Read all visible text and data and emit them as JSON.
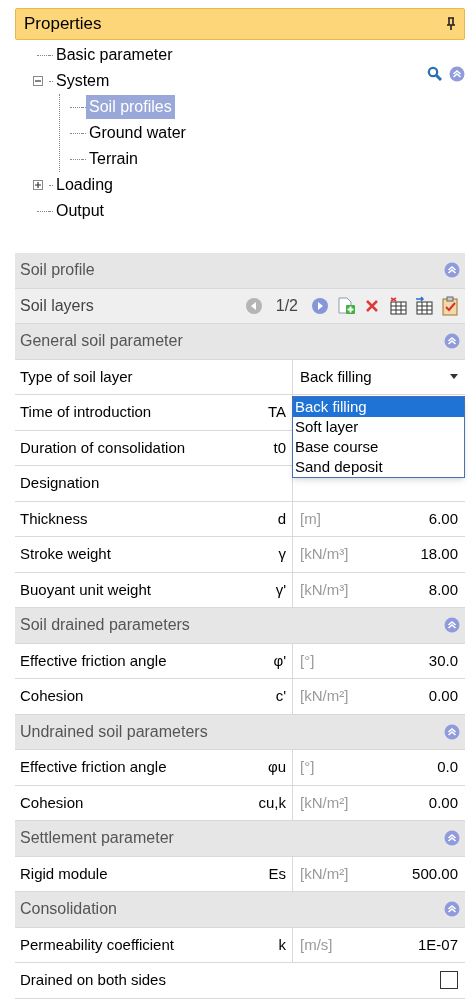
{
  "panel": {
    "title": "Properties"
  },
  "tree": [
    {
      "label": "Basic parameter",
      "selected": false
    },
    {
      "label": "System",
      "selected": false,
      "expanded": true,
      "children": [
        {
          "label": "Soil profiles",
          "selected": true
        },
        {
          "label": "Ground water",
          "selected": false
        },
        {
          "label": "Terrain",
          "selected": false
        }
      ]
    },
    {
      "label": "Loading",
      "selected": false,
      "expanded": false
    },
    {
      "label": "Output",
      "selected": false
    }
  ],
  "rows": [
    {
      "kind": "group",
      "title": "Soil profile",
      "expanded": true
    },
    {
      "kind": "pager",
      "label": "Soil layers",
      "page": "1/2"
    },
    {
      "kind": "group",
      "title": "General soil parameter",
      "expanded": true
    },
    {
      "kind": "select",
      "label": "Type of soil layer",
      "value": "Back filling",
      "open": true,
      "options": [
        {
          "label": "Back filling",
          "selected": true
        },
        {
          "label": "Soft layer",
          "selected": false
        },
        {
          "label": "Base course",
          "selected": false
        },
        {
          "label": "Sand deposit",
          "selected": false
        }
      ]
    },
    {
      "kind": "param",
      "label": "Time of introduction",
      "symbol": "TA"
    },
    {
      "kind": "param",
      "label": "Duration of consolidation",
      "symbol": "t0"
    },
    {
      "kind": "param",
      "label": "Designation"
    },
    {
      "kind": "param",
      "label": "Thickness",
      "symbol": "d",
      "unit": "[m]",
      "value": "6.00"
    },
    {
      "kind": "param",
      "label": "Stroke weight",
      "symbol": "γ",
      "unit": "[kN/m³]",
      "value": "18.00"
    },
    {
      "kind": "param",
      "label": "Buoyant unit weight",
      "symbol": "γ'",
      "unit": "[kN/m³]",
      "value": "8.00"
    },
    {
      "kind": "group",
      "title": "Soil drained parameters",
      "expanded": true
    },
    {
      "kind": "param",
      "label": "Effective friction angle",
      "symbol": "φ'",
      "unit": "[°]",
      "value": "30.0"
    },
    {
      "kind": "param",
      "label": "Cohesion",
      "symbol": "c'",
      "unit": "[kN/m²]",
      "value": "0.00"
    },
    {
      "kind": "group",
      "title": "Undrained soil parameters",
      "expanded": true
    },
    {
      "kind": "param",
      "label": "Effective friction angle",
      "symbol": "φu",
      "unit": "[°]",
      "value": "0.0"
    },
    {
      "kind": "param",
      "label": "Cohesion",
      "symbol": "cu,k",
      "unit": "[kN/m²]",
      "value": "0.00"
    },
    {
      "kind": "group",
      "title": "Settlement parameter",
      "expanded": true
    },
    {
      "kind": "param",
      "label": "Rigid module",
      "symbol": "Es",
      "unit": "[kN/m²]",
      "value": "500.00"
    },
    {
      "kind": "group",
      "title": "Consolidation",
      "expanded": true
    },
    {
      "kind": "param",
      "label": "Permeability coefficient",
      "symbol": "k",
      "unit": "[m/s]",
      "value": "1E-07"
    },
    {
      "kind": "checkbox",
      "label": "Drained on both sides",
      "checked": false
    }
  ]
}
